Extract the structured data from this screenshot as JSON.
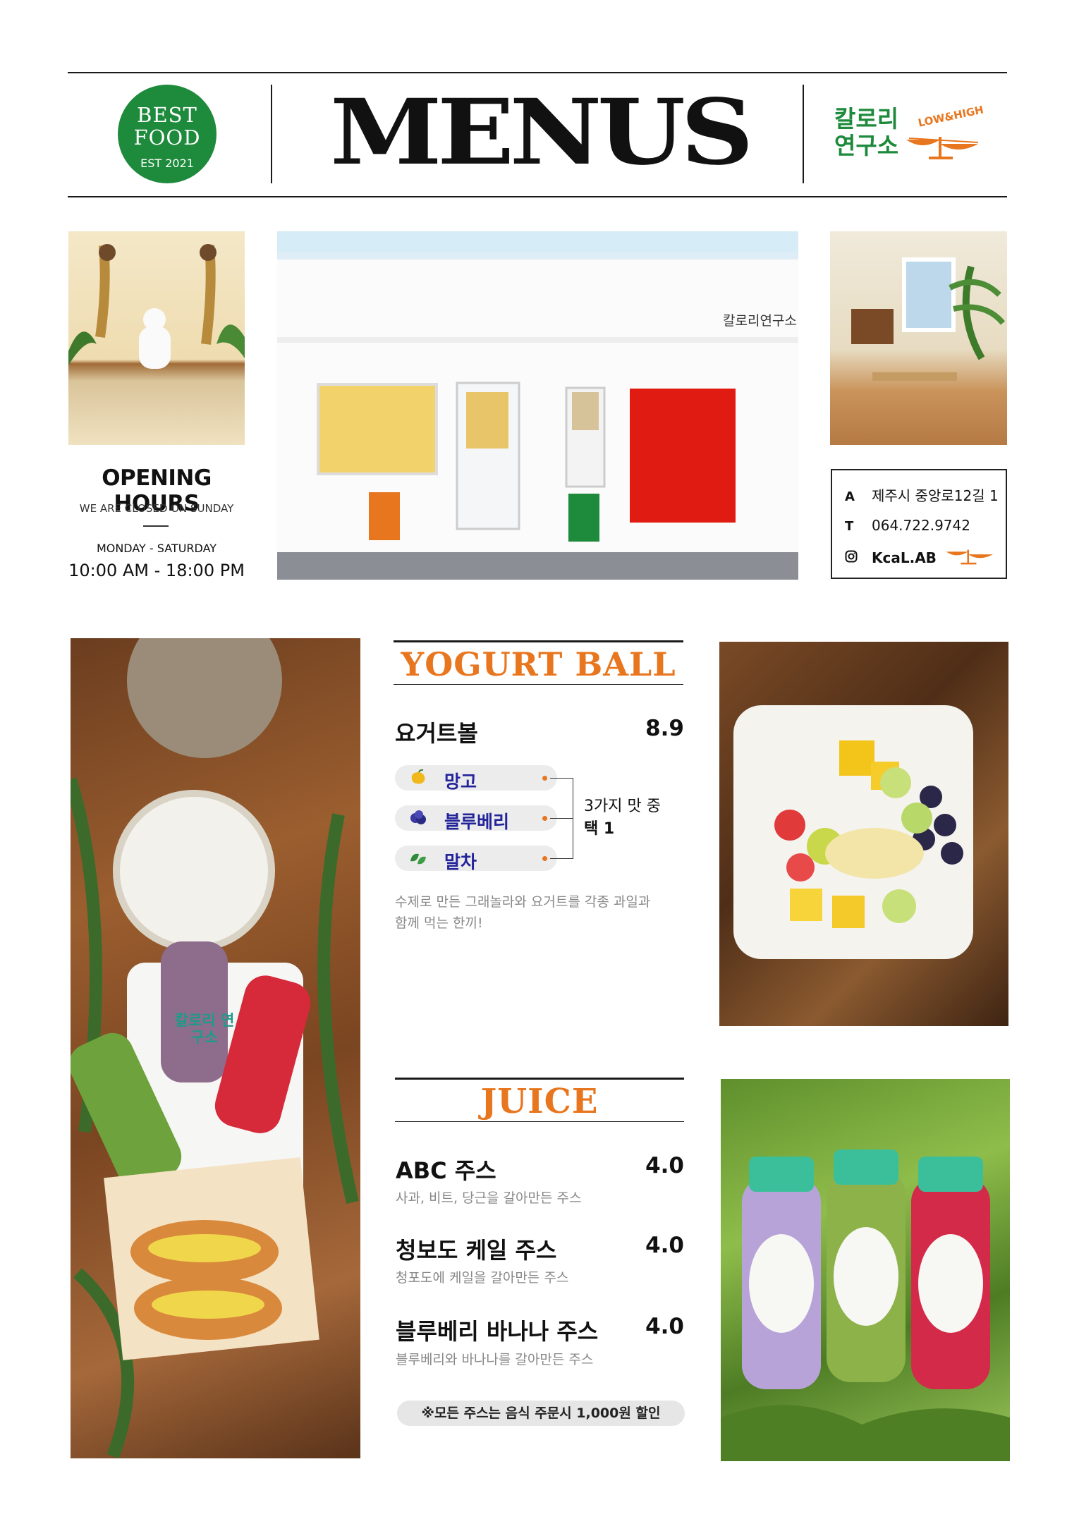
{
  "header": {
    "badge": {
      "line1": "BEST",
      "line2": "FOOD",
      "line3": "EST 2021"
    },
    "title": "MENUS",
    "brand": {
      "name_line1": "칼로리",
      "name_line2": "연구소",
      "tag": "LOW&HIGH"
    }
  },
  "photos": {
    "interior_left": "interior-photo",
    "storefront": "storefront-photo",
    "interior_right": "interior-photo",
    "storefront_sign": "칼로리연구소",
    "juice_tray": "juice-and-sandwich-photo",
    "yogurt_bowl": "yogurt-bowl-photo",
    "juice_bottles": "juice-bottles-photo",
    "bottle_label": "칼로리 연구소"
  },
  "hours": {
    "title": "OPENING HOURS",
    "closed_note": "WE ARE CLOSED ON SUNDAY",
    "days": "MONDAY - SATURDAY",
    "time": "10:00 AM - 18:00 PM"
  },
  "contact": {
    "address_key": "A",
    "address": "제주시 중앙로12길 1",
    "phone_key": "T",
    "phone": "064.722.9742",
    "instagram": "KcaL.AB",
    "instagram_icon": "instagram-icon"
  },
  "yogurt": {
    "section_title": "YOGURT BALL",
    "name": "요거트볼",
    "price": "8.9",
    "flavors": [
      {
        "icon": "mango-icon",
        "label": "망고"
      },
      {
        "icon": "blueberry-icon",
        "label": "블루베리"
      },
      {
        "icon": "matcha-leaf-icon",
        "label": "말차"
      }
    ],
    "choice_line1": "3가지 맛 중",
    "choice_line2": "택 1",
    "description_line1": "수제로 만든 그래놀라와 요거트를 각종 과일과",
    "description_line2": "함께 먹는 한끼!"
  },
  "juice": {
    "section_title": "JUICE",
    "items": [
      {
        "name": "ABC 주스",
        "price": "4.0",
        "desc": "사과, 비트, 당근을 갈아만든 주스"
      },
      {
        "name": "청보도 케일 주스",
        "price": "4.0",
        "desc": "청포도에 케일을 갈아만든 주스"
      },
      {
        "name": "블루베리 바나나 주스",
        "price": "4.0",
        "desc": "블루베리와 바나나를 갈아만든 주스"
      }
    ],
    "note": "※모든 주스는 음식 주문시 1,000원 할인"
  },
  "colors": {
    "brand_green": "#1e8a3c",
    "accent_orange": "#e8761e",
    "flavor_text": "#23249a"
  }
}
